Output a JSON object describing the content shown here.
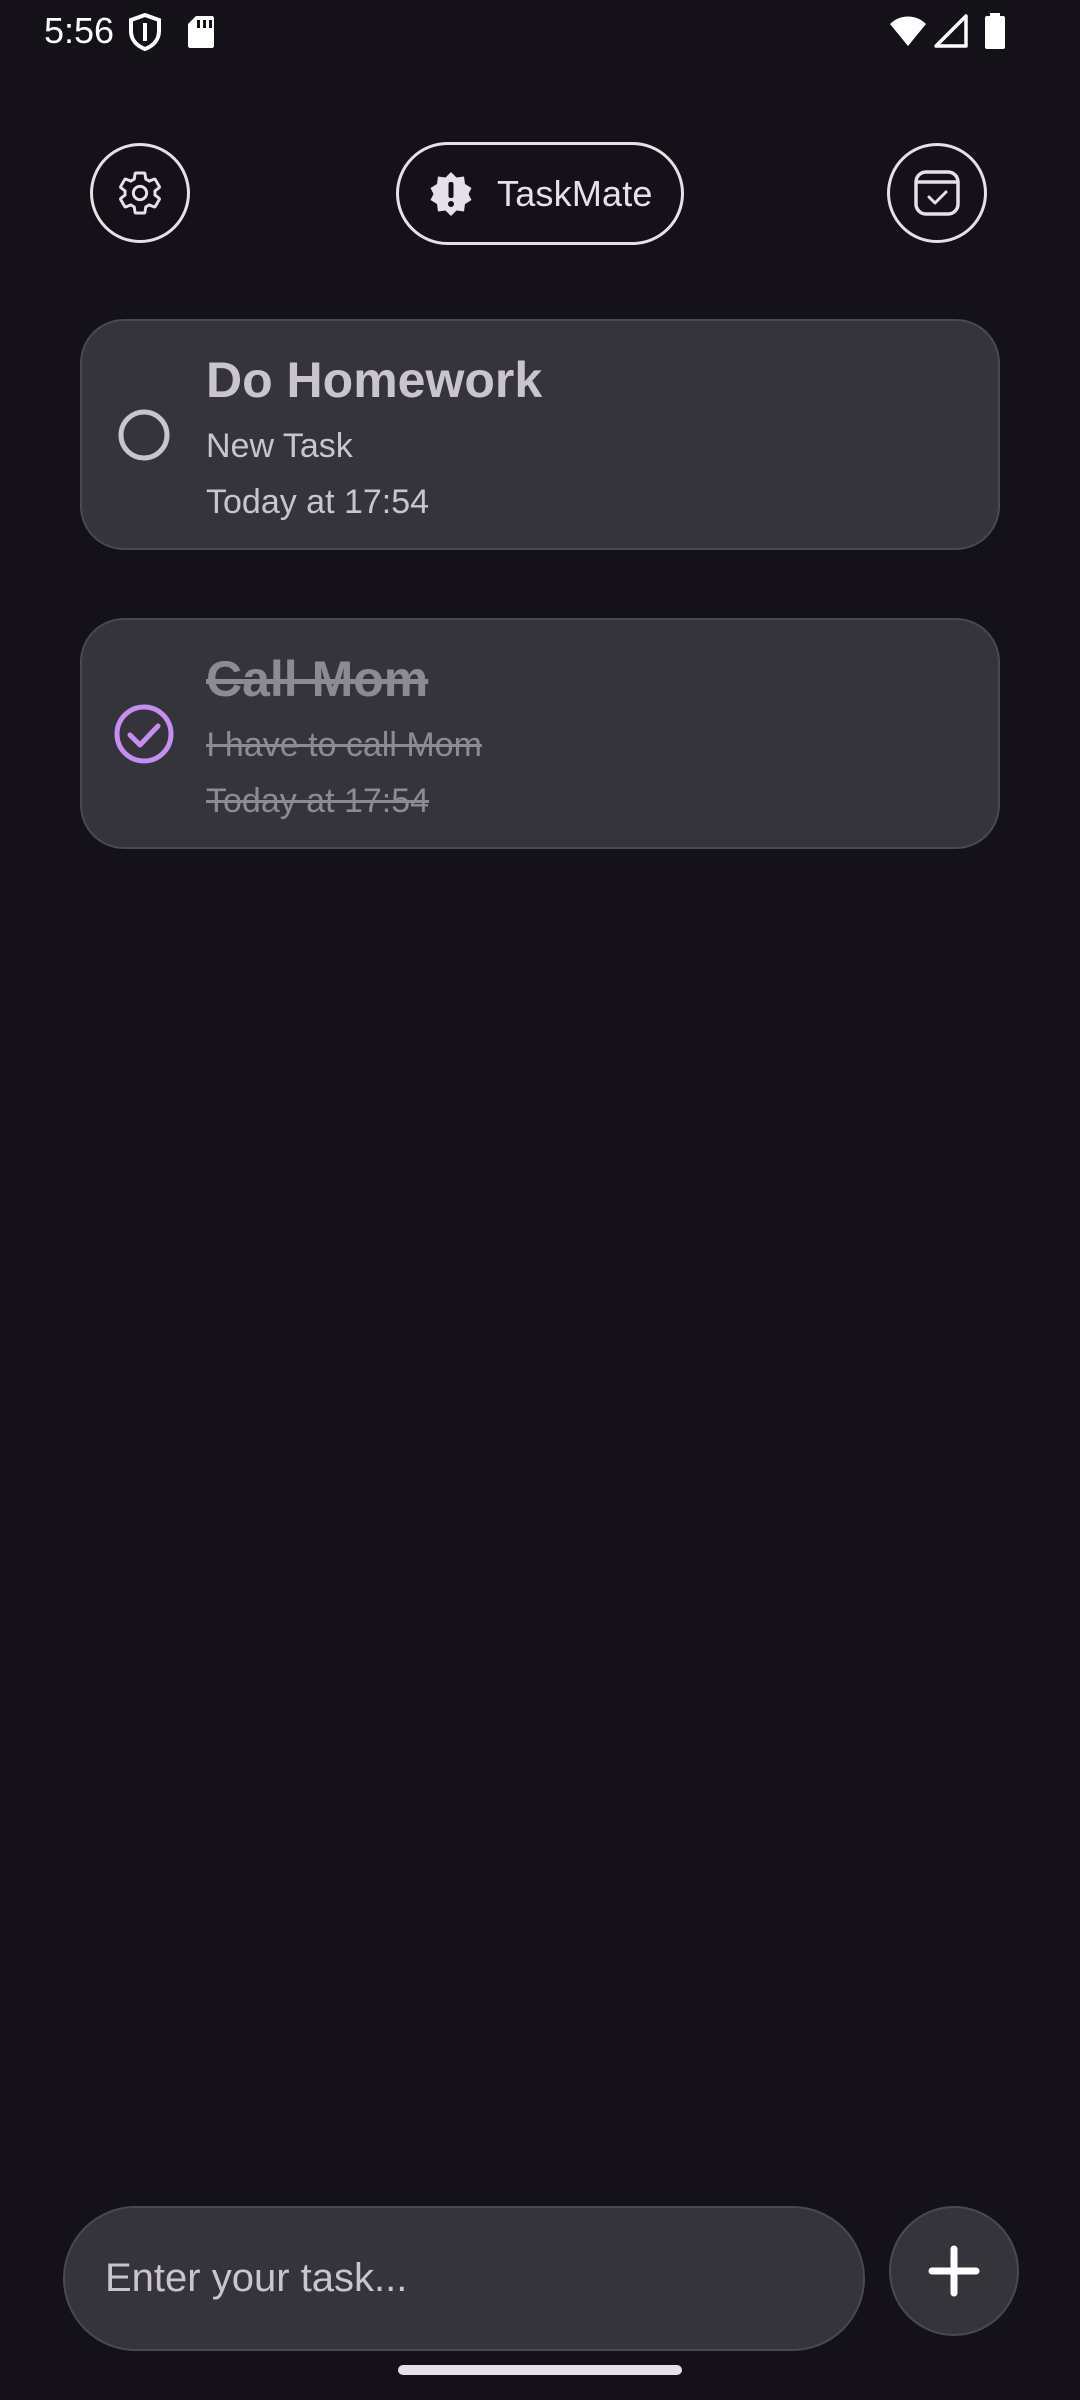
{
  "status_bar": {
    "time": "5:56",
    "icons": [
      "shield-icon",
      "sd-card-icon",
      "wifi-icon",
      "cell-signal-icon",
      "battery-icon"
    ]
  },
  "header": {
    "title": "TaskMate",
    "left_icon": "gear-icon",
    "title_icon": "alert-badge-icon",
    "right_icon": "calendar-check-icon"
  },
  "tasks": [
    {
      "title": "Do Homework",
      "description": "New Task",
      "time": "Today at 17:54",
      "completed": false
    },
    {
      "title": "Call Mom",
      "description": "I have to call Mom",
      "time": "Today at 17:54",
      "completed": true
    }
  ],
  "composer": {
    "placeholder": "Enter your task...",
    "add_icon": "plus-icon"
  },
  "colors": {
    "background": "#141218",
    "card": "#36343b",
    "accent": "#c68ef0",
    "text": "#cac4d0",
    "text_done": "#8d8a93"
  }
}
